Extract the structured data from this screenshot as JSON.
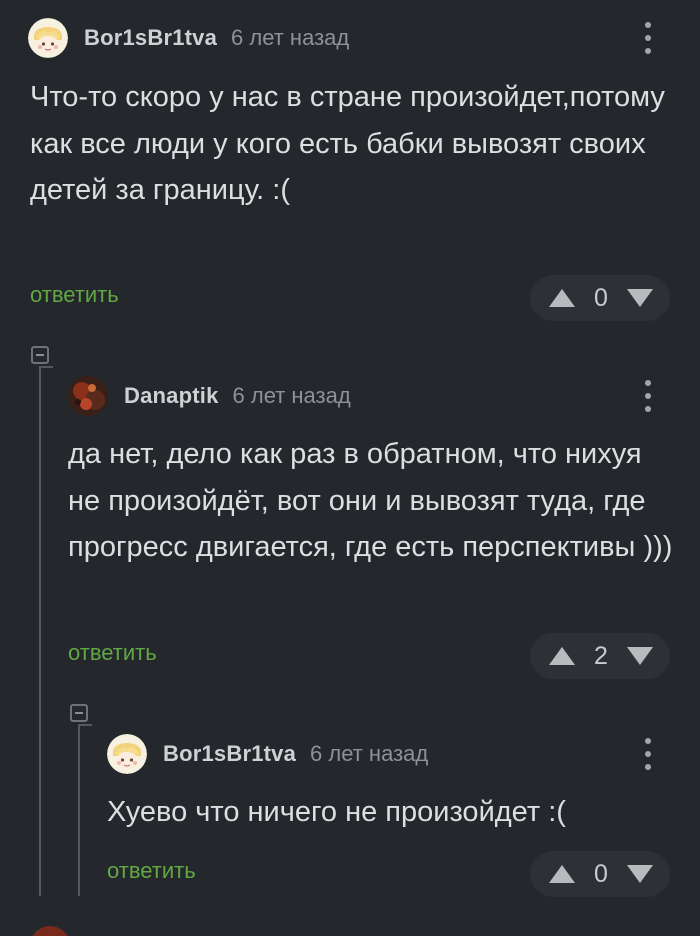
{
  "comments": [
    {
      "username": "Bor1sBr1tva",
      "time": "6 лет назад",
      "text": "Что-то скоро у нас в стране произойдет,потому как все люди у кого есть бабки вывозят своих детей за границу. :(",
      "reply_label": "ответить",
      "rating": "0",
      "avatar": "chibi-avatar-icon"
    },
    {
      "username": "Danaptik",
      "time": "6 лет назад",
      "text": "да нет, дело как раз в обратном, что нихуя не произойдёт, вот они и вывозят туда, где прогресс двигается, где есть перспективы )))",
      "reply_label": "ответить",
      "rating": "2",
      "avatar": "dark-red-avatar-icon"
    },
    {
      "username": "Bor1sBr1tva",
      "time": "6 лет назад",
      "text": "Хуево что ничего не произойдет :(",
      "reply_label": "ответить",
      "rating": "0",
      "avatar": "chibi-avatar-icon"
    }
  ],
  "colors": {
    "background": "#24272b",
    "reply_link": "#61a844",
    "username": "#cfd2d5",
    "timestamp": "#8e9296",
    "vote_pill": "#2d3136"
  }
}
